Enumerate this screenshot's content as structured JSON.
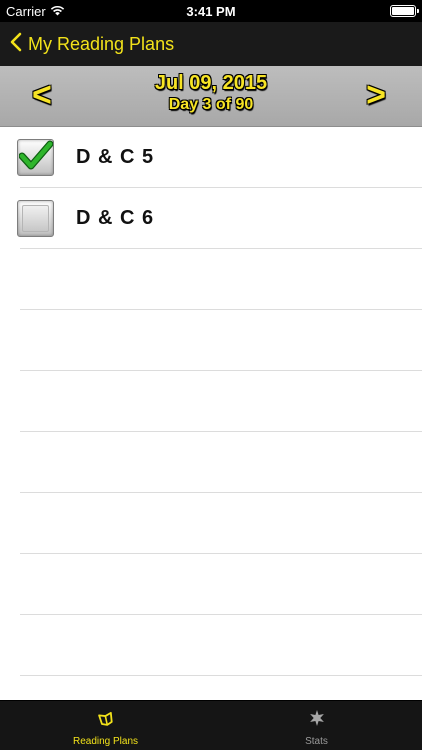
{
  "status_bar": {
    "carrier": "Carrier",
    "time": "3:41 PM",
    "icons": [
      "wifi-icon",
      "battery-icon"
    ]
  },
  "nav": {
    "back_label": "My Reading Plans",
    "back_icon": "chevron-left-icon",
    "accent_color": "#f2e21a"
  },
  "header": {
    "date": "Jul 09, 2015",
    "day": "Day 3 of 90",
    "prev": "<",
    "next": ">"
  },
  "readings": [
    {
      "label": "D & C 5",
      "checked": true
    },
    {
      "label": "D & C 6",
      "checked": false
    }
  ],
  "tabs": [
    {
      "label": "Reading Plans",
      "icon": "book-icon",
      "active": true
    },
    {
      "label": "Stats",
      "icon": "star-icon",
      "active": false
    }
  ]
}
